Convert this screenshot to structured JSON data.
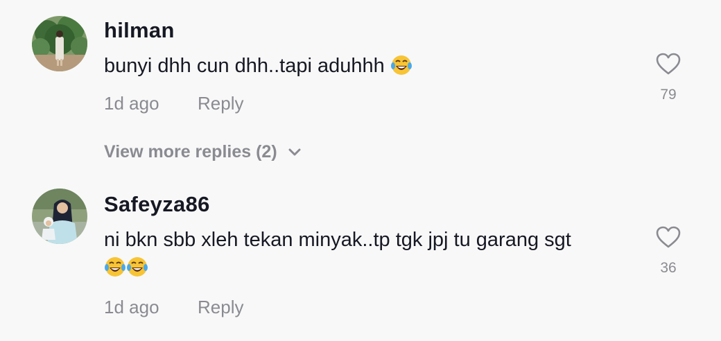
{
  "comments": [
    {
      "username": "hilman",
      "text": "bunyi dhh cun dhh..tapi aduhhh",
      "emoji": "😂",
      "time": "1d ago",
      "reply_label": "Reply",
      "like_count": "79",
      "view_more_replies": "View more replies (2)"
    },
    {
      "username": "Safeyza86",
      "text": "ni bkn sbb xleh tekan minyak..tp tgk jpj tu garang sgt",
      "emoji": "😂😂",
      "time": "1d ago",
      "reply_label": "Reply",
      "like_count": "36"
    }
  ],
  "icons": {
    "like": "heart-icon",
    "expand": "chevron-down-icon",
    "emoji": "face-with-tears-of-joy"
  },
  "colors": {
    "background": "#f8f8f8",
    "primary_text": "#161823",
    "secondary_text": "#8a8b91"
  }
}
